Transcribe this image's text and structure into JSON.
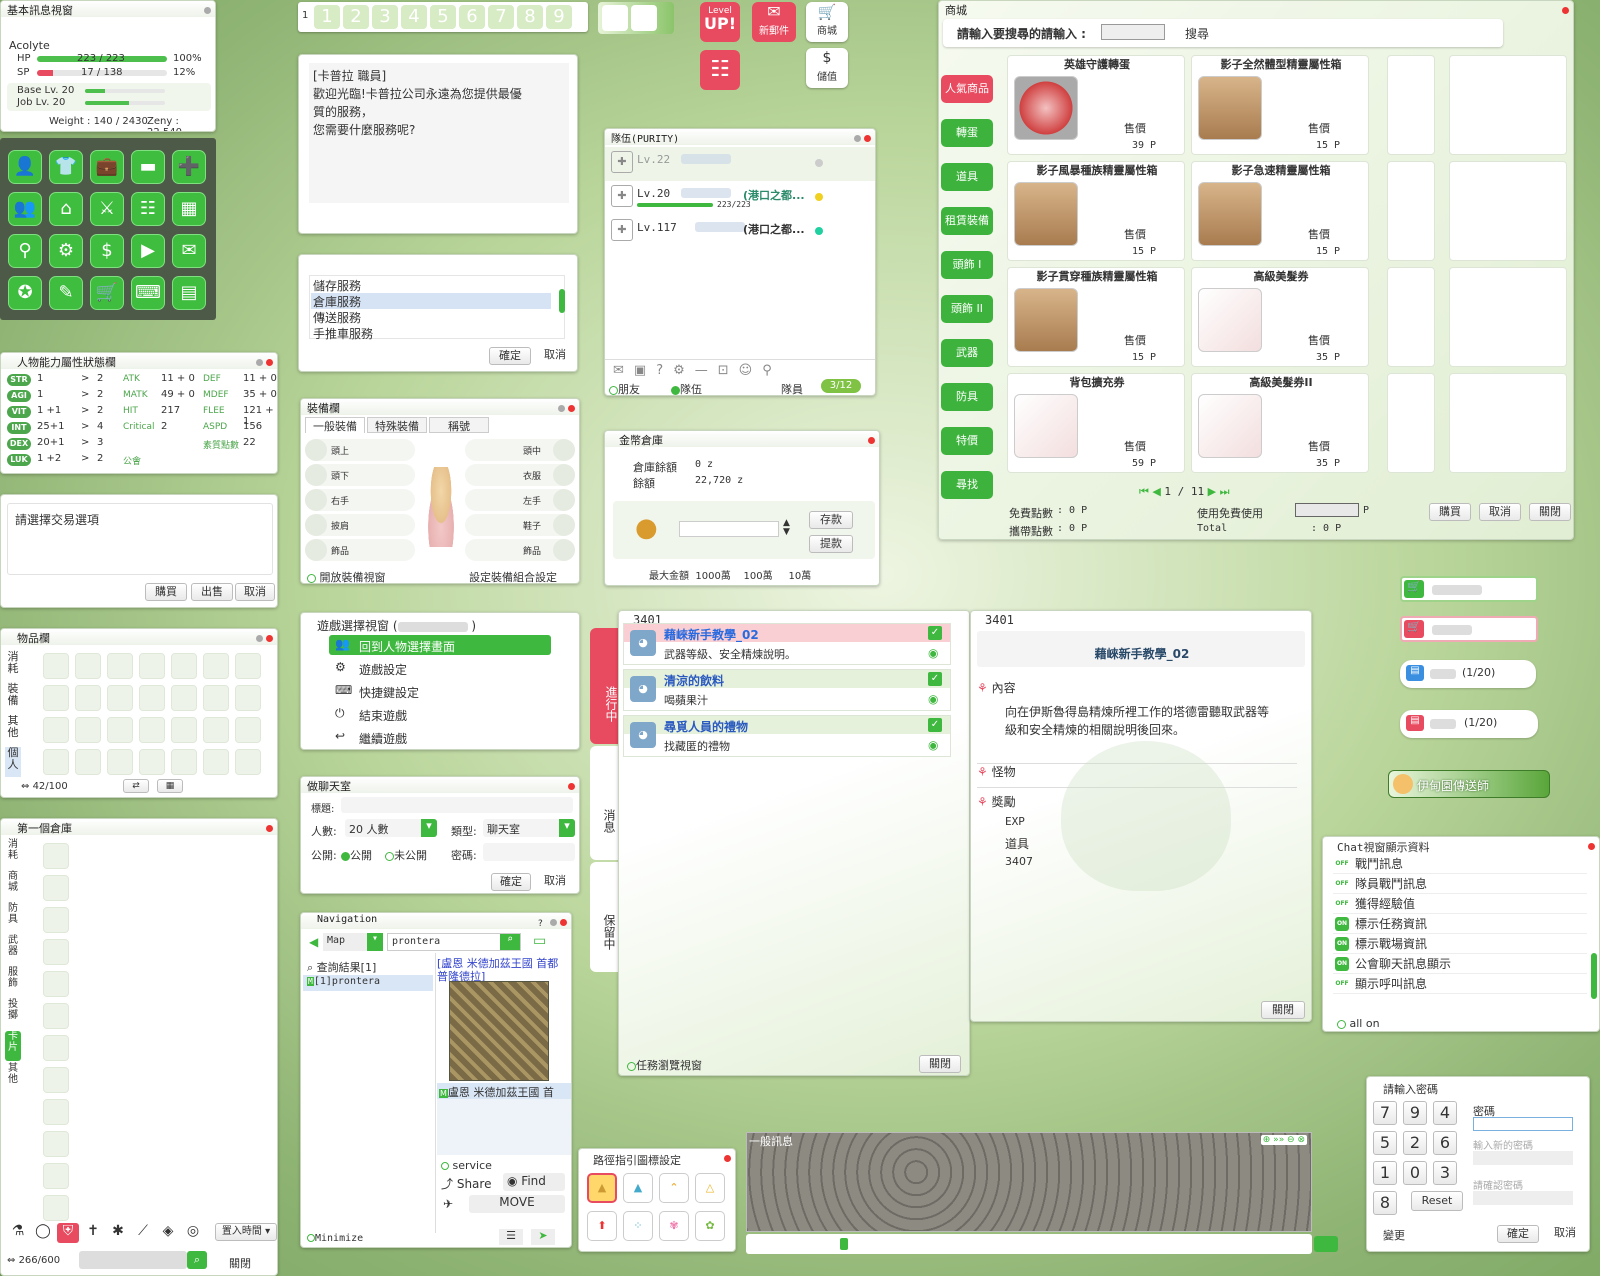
{
  "basic": {
    "title": "基本訊息視窗",
    "job": "Acolyte",
    "hp_label": "HP",
    "hp_value": "223  /  223",
    "hp_pct": "100%",
    "hp_fill": 1.0,
    "sp_label": "SP",
    "sp_value": "17  /  138",
    "sp_pct": "12%",
    "sp_fill": 0.12,
    "base_lv": "Base Lv. 20",
    "job_lv": "Job Lv. 20",
    "weight": "Weight : 140 / 2430",
    "zeny": "Zeny : 22,540"
  },
  "icon_grid": [
    "person-icon",
    "shirt-icon",
    "briefcase-icon",
    "book-icon",
    "add-person-icon",
    "group-icon",
    "home-icon",
    "sword-icon",
    "clipboard-icon",
    "map-icon",
    "pin-icon",
    "gear-icon",
    "dollar-icon",
    "video-icon",
    "mail-icon",
    "medal-icon",
    "chat-icon",
    "cart-icon",
    "keyboard-icon",
    "calendar-icon"
  ],
  "stats": {
    "title": "人物能力屬性狀態欄",
    "rows": [
      {
        "name": "STR",
        "base": "1",
        "arrow": ">",
        "cost": "2",
        "k1": "ATK",
        "v1": "11 + 0",
        "k2": "DEF",
        "v2": "11 + 0"
      },
      {
        "name": "AGI",
        "base": "1",
        "arrow": ">",
        "cost": "2",
        "k1": "MATK",
        "v1": "49 + 0",
        "k2": "MDEF",
        "v2": "35 + 0"
      },
      {
        "name": "VIT",
        "base": "1  +1",
        "arrow": ">",
        "cost": "2",
        "k1": "HIT",
        "v1": "217",
        "k2": "FLEE",
        "v2": "121 + 1"
      },
      {
        "name": "INT",
        "base": "25+1",
        "arrow": ">",
        "cost": "4",
        "k1": "Critical",
        "v1": "2",
        "k2": "ASPD",
        "v2": "156"
      },
      {
        "name": "DEX",
        "base": "20+1",
        "arrow": ">",
        "cost": "3",
        "k1": "",
        "v1": "",
        "k2": "素質點數",
        "v2": "22"
      },
      {
        "name": "LUK",
        "base": "1  +2",
        "arrow": ">",
        "cost": "2",
        "k1": "公會",
        "v1": "",
        "k2": "",
        "v2": ""
      }
    ]
  },
  "trade": {
    "prompt": "請選擇交易選項",
    "buy": "購買",
    "sell": "出售",
    "cancel": "取消"
  },
  "inventory": {
    "title": "物品欄",
    "tabs": [
      "消耗",
      "裝備",
      "其他",
      "個人"
    ],
    "count": "42/100"
  },
  "storage": {
    "title": "第一個倉庫",
    "tabs": [
      "消耗",
      "商城",
      "防具",
      "武器",
      "服飾",
      "投擲",
      "卡片",
      "其他"
    ],
    "count": "266/600",
    "sort": "置入時間",
    "close": "關閉"
  },
  "hotbar": {
    "row": "1",
    "slots": [
      "1",
      "2",
      "3",
      "4",
      "5",
      "6",
      "7",
      "8",
      "9"
    ]
  },
  "top_icons": {
    "levelup_small": "Level",
    "levelup_big": "UP!",
    "mail": "新郵件",
    "shop": "商城",
    "deposit": "儲值"
  },
  "npc": {
    "speaker": "[卡普拉 職員]",
    "lines": [
      "歡迎光臨!卡普拉公司永遠為您提供最優",
      "質的服務，",
      "您需要什麼服務呢?"
    ]
  },
  "service": {
    "options": [
      "儲存服務",
      "倉庫服務",
      "傳送服務",
      "手推車服務"
    ],
    "ok": "確定",
    "cancel": "取消"
  },
  "equip": {
    "title": "裝備欄",
    "tabs": [
      "一般裝備",
      "特殊裝備",
      "稱號"
    ],
    "left": [
      "頭上",
      "頭下",
      "右手",
      "披肩",
      "飾品"
    ],
    "right": [
      "頭中",
      "衣服",
      "左手",
      "鞋子",
      "飾品"
    ],
    "open_view": "開放裝備視窗",
    "set_combo": "設定裝備組合設定"
  },
  "game_menu": {
    "title": "遊戲選擇視窗 (",
    "items": [
      "回到人物選擇畫面",
      "遊戲設定",
      "快捷鍵設定",
      "結束遊戲",
      "繼續遊戲"
    ]
  },
  "chat_room": {
    "title": "做聊天室",
    "label_title": "標題:",
    "label_people": "人數:",
    "people": "20 人數",
    "label_type": "類型:",
    "type": "聊天室",
    "label_public": "公開:",
    "public": "公開",
    "private": "未公開",
    "label_pw": "密碼:",
    "ok": "確定",
    "cancel": "取消"
  },
  "nav": {
    "title": "Navigation",
    "mode": "Map",
    "query": "prontera",
    "results": "查詢結果[1]",
    "result_item": "[1]prontera",
    "map_title": "[盧恩 米德加茲王國 首都 普隆德拉]",
    "map_caption": "盧恩 米德加茲王國 首",
    "service": "service",
    "share": "Share",
    "find": "Find",
    "move": "MOVE",
    "minimize": "Minimize"
  },
  "party": {
    "title": "隊伍(PURITY)",
    "members": [
      {
        "lv": "Lv.22",
        "loc": ""
      },
      {
        "lv": "Lv.20",
        "loc": "(港口之都...",
        "hp": "223/223"
      },
      {
        "lv": "Lv.117",
        "loc": "(港口之都..."
      }
    ],
    "friends": "朋友",
    "party_tab": "隊伍",
    "members_label": "隊員",
    "count": "3/12"
  },
  "coin": {
    "title": "金幣倉庫",
    "storage_label": "倉庫餘額",
    "storage_val": "0 z",
    "balance_label": "餘額",
    "balance_val": "22,720 z",
    "deposit": "存款",
    "withdraw": "提款",
    "max_label": "最大金額",
    "m1": "1000萬",
    "m2": "100萬",
    "m3": "10萬"
  },
  "cashshop": {
    "title": "商城",
    "search_label": "請輸入要搜尋的請輸入 :",
    "search_btn": "搜尋",
    "cats": [
      "人氣商品",
      "轉蛋",
      "道具",
      "租賃裝備",
      "頭飾 I",
      "頭飾 II",
      "武器",
      "防具",
      "特價",
      "尋找"
    ],
    "items": [
      {
        "name": "英雄守護轉蛋",
        "price": "39 P",
        "icon": "shield-icon"
      },
      {
        "name": "影子全然體型精靈屬性箱",
        "price": "15 P",
        "icon": "box-icon"
      },
      {
        "name": "影子風暴種族精靈屬性箱",
        "price": "15 P",
        "icon": "box-icon"
      },
      {
        "name": "影子急速精靈屬性箱",
        "price": "15 P",
        "icon": "box-icon"
      },
      {
        "name": "影子貫穿種族精靈屬性箱",
        "price": "15 P",
        "icon": "box-icon"
      },
      {
        "name": "高級美髮券",
        "price": "35 P",
        "icon": "ticket-icon"
      },
      {
        "name": "背包擴充券",
        "price": "59 P",
        "icon": "ticket-icon"
      },
      {
        "name": "高級美髮券II",
        "price": "35 P",
        "icon": "ticket-icon"
      }
    ],
    "price_label": "售價",
    "page": "1 / 11",
    "free_label": "免費點數",
    "free_val": ": 0 P",
    "carry_label": "攜帶點數",
    "carry_val": ": 0 P",
    "use_free": "使用免費使用",
    "p": "P",
    "total": "Total",
    "total_val": ":          0 P",
    "buy": "購買",
    "cancel": "取消",
    "close": "關閉"
  },
  "quest": {
    "id": "3401",
    "tabs": [
      "進行中",
      "消息",
      "保留中"
    ],
    "items": [
      {
        "name": "藉崍新手教學_02",
        "desc": "武器等級、安全精煉說明。"
      },
      {
        "name": "清涼的飲料",
        "desc": "喝蘋果汁"
      },
      {
        "name": "尋覓人員的禮物",
        "desc": "找藏匿的禮物"
      }
    ],
    "view": "任務瀏覽視窗",
    "close": "關閉"
  },
  "quest_detail": {
    "id": "3401",
    "name": "藉崍新手教學_02",
    "content_label": "內容",
    "content": [
      "向在伊斯魯得島精煉所裡工作的塔德雷聽取武器等",
      "級和安全精煉的相關說明後回來。"
    ],
    "monster": "怪物",
    "reward": "獎勵",
    "exp": "EXP",
    "item": "道具",
    "item_id": "3407",
    "close": "關閉"
  },
  "vend": {
    "b3": "(1/20)",
    "b4": "(1/20)",
    "warp": "伊甸園傳送師"
  },
  "chat_cfg": {
    "title": "Chat視窗顯示資料",
    "rows": [
      {
        "s": "OFF",
        "t": "戰鬥訊息"
      },
      {
        "s": "OFF",
        "t": "隊員戰鬥訊息"
      },
      {
        "s": "OFF",
        "t": "獲得經驗值"
      },
      {
        "s": "ON",
        "t": "標示任務資訊"
      },
      {
        "s": "ON",
        "t": "標示戰場資訊"
      },
      {
        "s": "ON",
        "t": "公會聊天訊息顯示"
      },
      {
        "s": "OFF",
        "t": "顯示呼叫訊息"
      }
    ],
    "all_on": "all on"
  },
  "pw": {
    "title": "請輸入密碼",
    "keys": [
      "7",
      "9",
      "4",
      "5",
      "2",
      "6",
      "1",
      "0",
      "3",
      "8"
    ],
    "reset": "Reset",
    "pw_label": "密碼",
    "new_pw": "輸入新的密碼",
    "confirm_pw": "請確認密碼",
    "change": "變更",
    "ok": "確定",
    "cancel": "取消"
  },
  "route": {
    "title": "路徑指引圖標設定"
  },
  "general": {
    "title": "一般訊息"
  },
  "colors": {
    "green": "#3fb83f",
    "red": "#e84a5f",
    "accent": "#4ca64c"
  }
}
